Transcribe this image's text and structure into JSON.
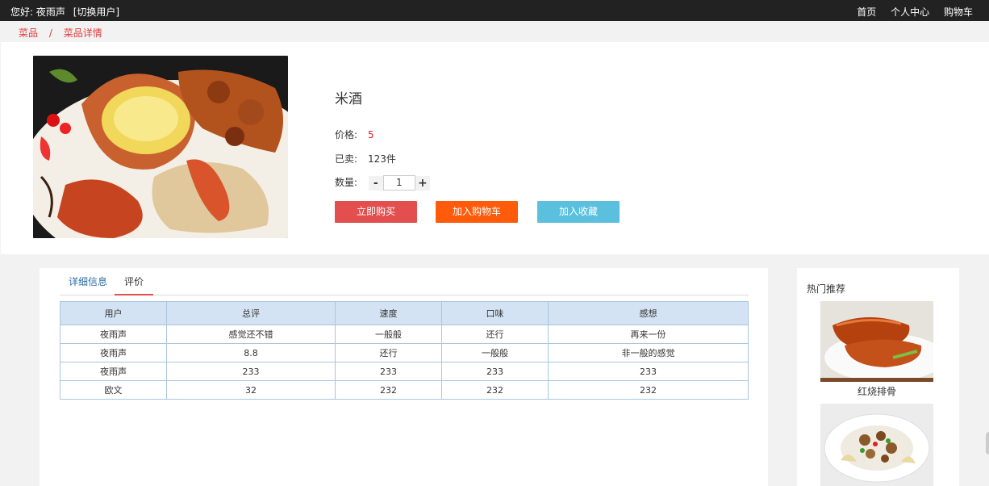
{
  "topbar": {
    "greeting": "您好: 夜雨声",
    "switch_user": "[切换用户]",
    "nav": [
      "首页",
      "个人中心",
      "购物车"
    ]
  },
  "breadcrumb": {
    "items": [
      "菜品",
      "菜品详情"
    ],
    "separator": "/"
  },
  "product": {
    "name": "米酒",
    "price_label": "价格:",
    "price": "5",
    "sold_label": "已卖:",
    "sold": "123件",
    "qty_label": "数量:",
    "qty_minus": "-",
    "qty_value": "1",
    "qty_plus": "+",
    "buy_now": "立即购买",
    "add_cart": "加入购物车",
    "add_fav": "加入收藏"
  },
  "tabs": [
    "详细信息",
    "评价"
  ],
  "reviews": {
    "columns": [
      "用户",
      "总评",
      "速度",
      "口味",
      "感想"
    ],
    "rows": [
      [
        "夜雨声",
        "感觉还不错",
        "一般般",
        "还行",
        "再来一份"
      ],
      [
        "夜雨声",
        "8.8",
        "还行",
        "一般般",
        "非一般的感觉"
      ],
      [
        "夜雨声",
        "233",
        "233",
        "233",
        "233"
      ],
      [
        "欧文",
        "32",
        "232",
        "232",
        "232"
      ]
    ]
  },
  "sidebar": {
    "title": "热门推荐",
    "items": [
      {
        "name": "红烧排骨"
      },
      {
        "name": ""
      }
    ]
  },
  "colors": {
    "accent_red": "#e34f4f",
    "orange": "#ff5b0a",
    "cyan": "#5bc0de",
    "table_header": "#d4e3f3"
  }
}
